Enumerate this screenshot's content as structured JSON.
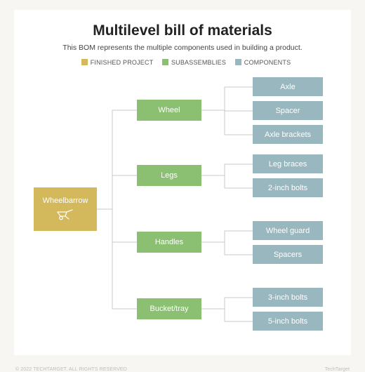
{
  "title": "Multilevel bill of materials",
  "subtitle": "This BOM represents the multiple components used in building a product.",
  "legend": {
    "finished": "FINISHED PROJECT",
    "sub": "SUBASSEMBLIES",
    "comp": "COMPONENTS"
  },
  "root": {
    "label": "Wheelbarrow"
  },
  "subs": [
    {
      "label": "Wheel"
    },
    {
      "label": "Legs"
    },
    {
      "label": "Handles"
    },
    {
      "label": "Bucket/tray"
    }
  ],
  "comps": [
    {
      "label": "Axle"
    },
    {
      "label": "Spacer"
    },
    {
      "label": "Axle brackets"
    },
    {
      "label": "Leg braces"
    },
    {
      "label": "2-inch bolts"
    },
    {
      "label": "Wheel guard"
    },
    {
      "label": "Spacers"
    },
    {
      "label": "3-inch bolts"
    },
    {
      "label": "5-inch bolts"
    }
  ],
  "footer": {
    "copyright": "© 2022 TECHTARGET. ALL RIGHTS RESERVED",
    "brand": "TechTarget"
  },
  "colors": {
    "finished": "#d3b85c",
    "sub": "#8bbf72",
    "comp": "#99b7be"
  }
}
